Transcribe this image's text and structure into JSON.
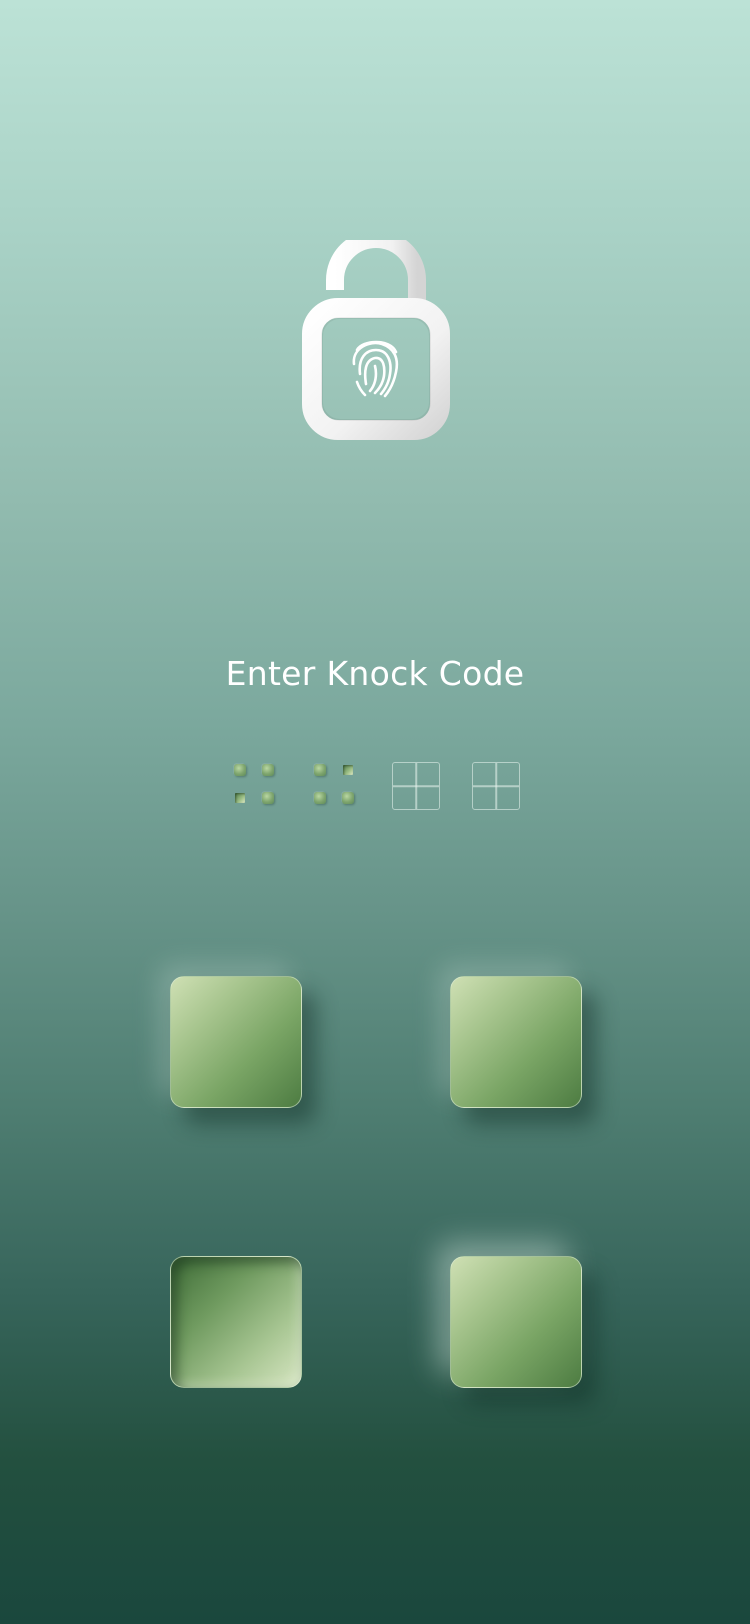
{
  "screen": {
    "title": "Enter Knock Code"
  },
  "icons": {
    "lock": "unlocked-padlock-fingerprint-icon"
  },
  "code_progress": {
    "total_digits": 4,
    "entered_digits": 2
  },
  "colors": {
    "background_top": "#bce2d6",
    "background_bottom": "#1a473d",
    "pad_light": "#cfe0b4",
    "pad_dark": "#4d7c42",
    "text": "#ffffff"
  }
}
